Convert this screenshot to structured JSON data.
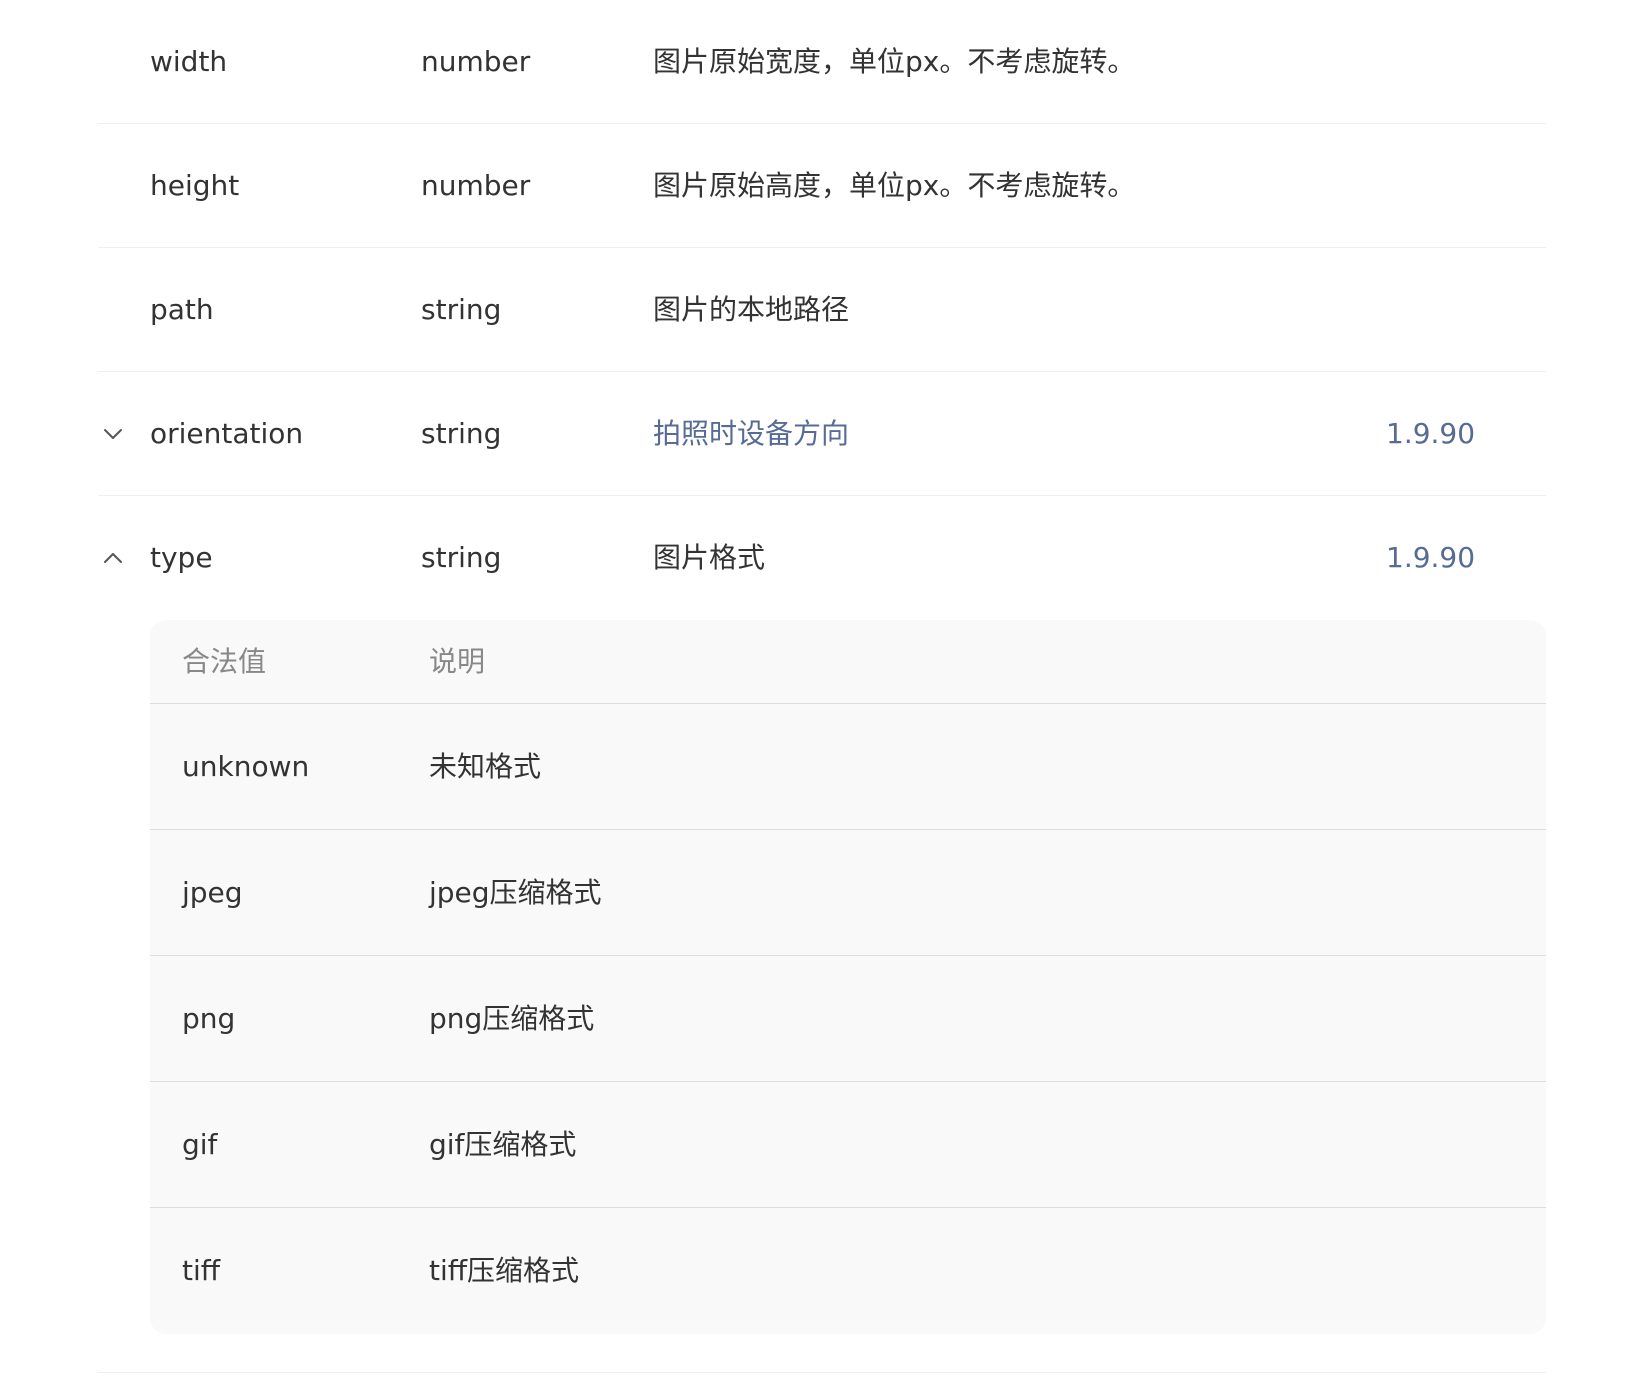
{
  "rows": [
    {
      "name": "width",
      "type": "number",
      "desc": "图片原始宽度，单位px。不考虑旋转。",
      "version": ""
    },
    {
      "name": "height",
      "type": "number",
      "desc": "图片原始高度，单位px。不考虑旋转。",
      "version": ""
    },
    {
      "name": "path",
      "type": "string",
      "desc": "图片的本地路径",
      "version": ""
    },
    {
      "name": "orientation",
      "type": "string",
      "desc": "拍照时设备方向",
      "version": "1.9.90",
      "toggle_icon": "chevron-down-icon"
    },
    {
      "name": "type",
      "type": "string",
      "desc": "图片格式",
      "version": "1.9.90",
      "toggle_icon": "chevron-up-icon"
    }
  ],
  "type_values": {
    "header": {
      "value": "合法值",
      "desc": "说明"
    },
    "items": [
      {
        "value": "unknown",
        "desc": "未知格式"
      },
      {
        "value": "jpeg",
        "desc": "jpeg压缩格式"
      },
      {
        "value": "png",
        "desc": "png压缩格式"
      },
      {
        "value": "gif",
        "desc": "gif压缩格式"
      },
      {
        "value": "tiff",
        "desc": "tiff压缩格式"
      }
    ]
  },
  "colors": {
    "link": "#576b95",
    "text": "#333333",
    "muted": "#888888",
    "subtable_bg": "#f9f9f9",
    "divider": "#eeeeee"
  }
}
